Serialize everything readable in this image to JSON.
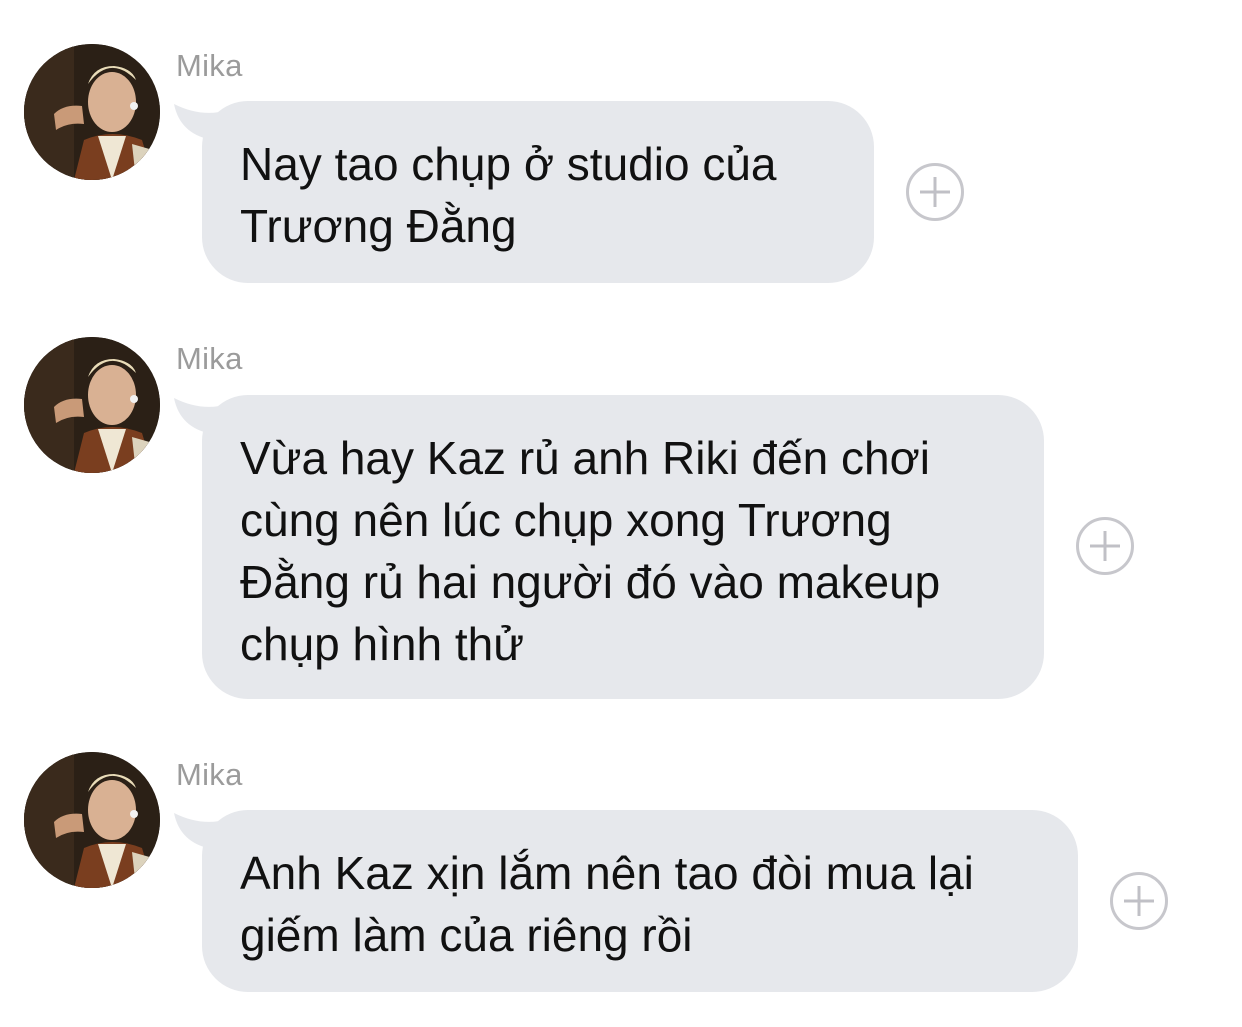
{
  "colors": {
    "bubble": "#e6e8ec",
    "sender": "#9b9b9b",
    "text": "#111111",
    "react_icon": "#c7c7cc"
  },
  "messages": [
    {
      "sender": "Mika",
      "text": "Nay tao chụp ở studio của\nTrương Đằng",
      "avatar_icon": "avatar",
      "reaction_icon": "add-reaction-icon"
    },
    {
      "sender": "Mika",
      "text": "Vừa hay Kaz rủ anh Riki đến chơi\ncùng nên lúc chụp xong Trương\nĐằng rủ hai người đó vào makeup\nchụp hình thử",
      "avatar_icon": "avatar",
      "reaction_icon": "add-reaction-icon"
    },
    {
      "sender": "Mika",
      "text": "Anh Kaz xịn lắm nên tao đòi mua lại\ngiếm làm của riêng rồi",
      "avatar_icon": "avatar",
      "reaction_icon": "add-reaction-icon"
    }
  ]
}
